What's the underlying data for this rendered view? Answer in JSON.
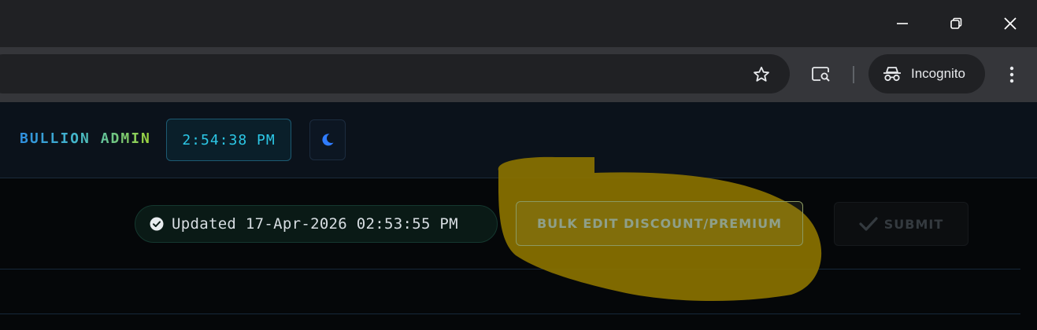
{
  "browser": {
    "incognito_label": "Incognito",
    "icons": {
      "minimize": "minimize-icon",
      "restore": "restore-icon",
      "close": "close-icon",
      "bookmark": "star-icon",
      "lens": "search-page-icon",
      "incognito": "incognito-icon",
      "menu": "more-vertical-icon"
    }
  },
  "app": {
    "brand_first": "BULLION",
    "brand_second": "ADMIN",
    "clock": "2:54:38 PM",
    "theme_icon": "moon-icon"
  },
  "actions": {
    "updated_text": "Updated 17-Apr-2026 02:53:55 PM",
    "updated_icon": "check-circle-icon",
    "bulk_edit_label": "BULK EDIT DISCOUNT/PREMIUM",
    "submit_label": "SUBMIT",
    "submit_icon": "check-icon"
  },
  "colors": {
    "page_bg": "#050709",
    "header_bg": "#0b121b",
    "clock_text": "#2cc7e6",
    "moon": "#2f7cff",
    "highlight": "#8a7200"
  }
}
